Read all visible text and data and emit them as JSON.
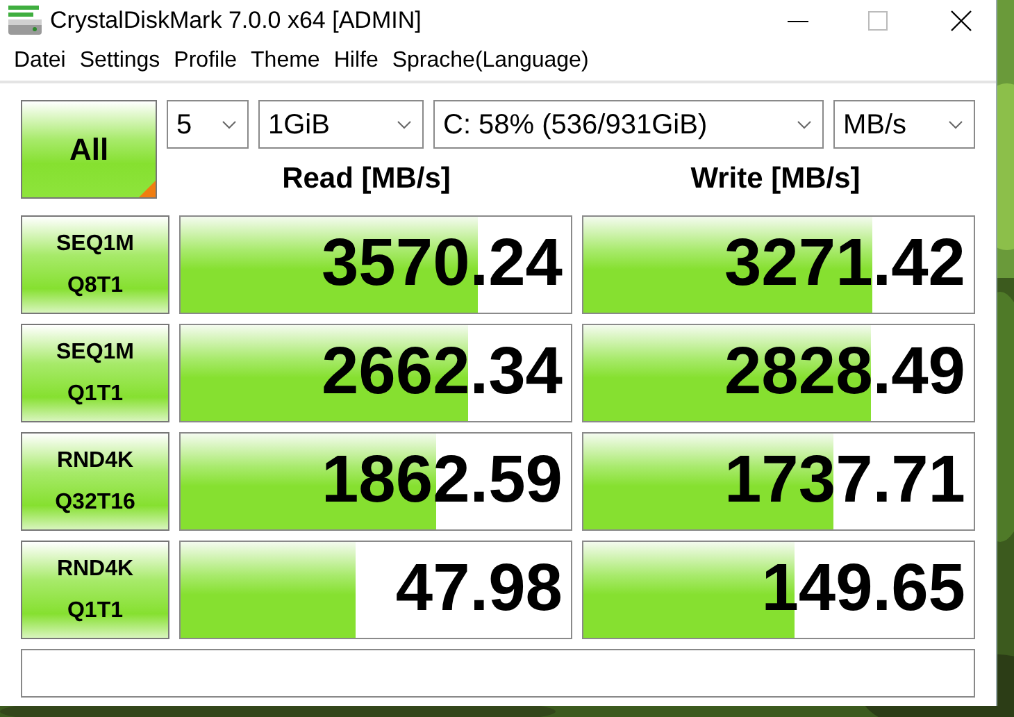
{
  "window": {
    "title": "CrystalDiskMark 7.0.0 x64 [ADMIN]"
  },
  "menu": [
    "Datei",
    "Settings",
    "Profile",
    "Theme",
    "Hilfe",
    "Sprache(Language)"
  ],
  "all_button": {
    "label": "All"
  },
  "selectors": [
    {
      "value": "5"
    },
    {
      "value": "1GiB"
    },
    {
      "value": "C: 58% (536/931GiB)"
    },
    {
      "value": "MB/s"
    }
  ],
  "headers": [
    "Read [MB/s]",
    "Write [MB/s]"
  ],
  "tests": [
    {
      "line1": "SEQ1M",
      "line2": "Q8T1",
      "read": {
        "value": "3570.24",
        "level": 0.76
      },
      "write": {
        "value": "3271.42",
        "level": 0.74
      }
    },
    {
      "line1": "SEQ1M",
      "line2": "Q1T1",
      "read": {
        "value": "2662.34",
        "level": 0.735
      },
      "write": {
        "value": "2828.49",
        "level": 0.735
      }
    },
    {
      "line1": "RND4K",
      "line2": "Q32T16",
      "read": {
        "value": "1862.59",
        "level": 0.655
      },
      "write": {
        "value": "1737.71",
        "level": 0.64
      }
    },
    {
      "line1": "RND4K",
      "line2": "Q1T1",
      "read": {
        "value": "47.98",
        "level": 0.45
      },
      "write": {
        "value": "149.65",
        "level": 0.54
      }
    }
  ]
}
